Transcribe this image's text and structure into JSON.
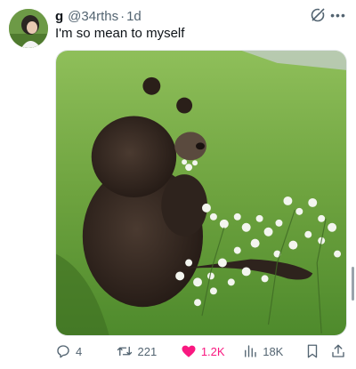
{
  "tweet": {
    "display_name": "g",
    "handle": "@34rths",
    "separator": "·",
    "time": "1d",
    "text": "I'm so mean to myself"
  },
  "header_icons": {
    "grok": "grok-icon",
    "more": "more-icon",
    "more_glyph": "•••"
  },
  "media": {
    "description_icon": "image"
  },
  "actions": {
    "replies": "4",
    "retweets": "221",
    "likes": "1.2K",
    "views": "18K",
    "liked": true,
    "like_color": "#f91880"
  },
  "colors": {
    "text": "#0f1419",
    "secondary": "#536471",
    "like": "#f91880"
  }
}
